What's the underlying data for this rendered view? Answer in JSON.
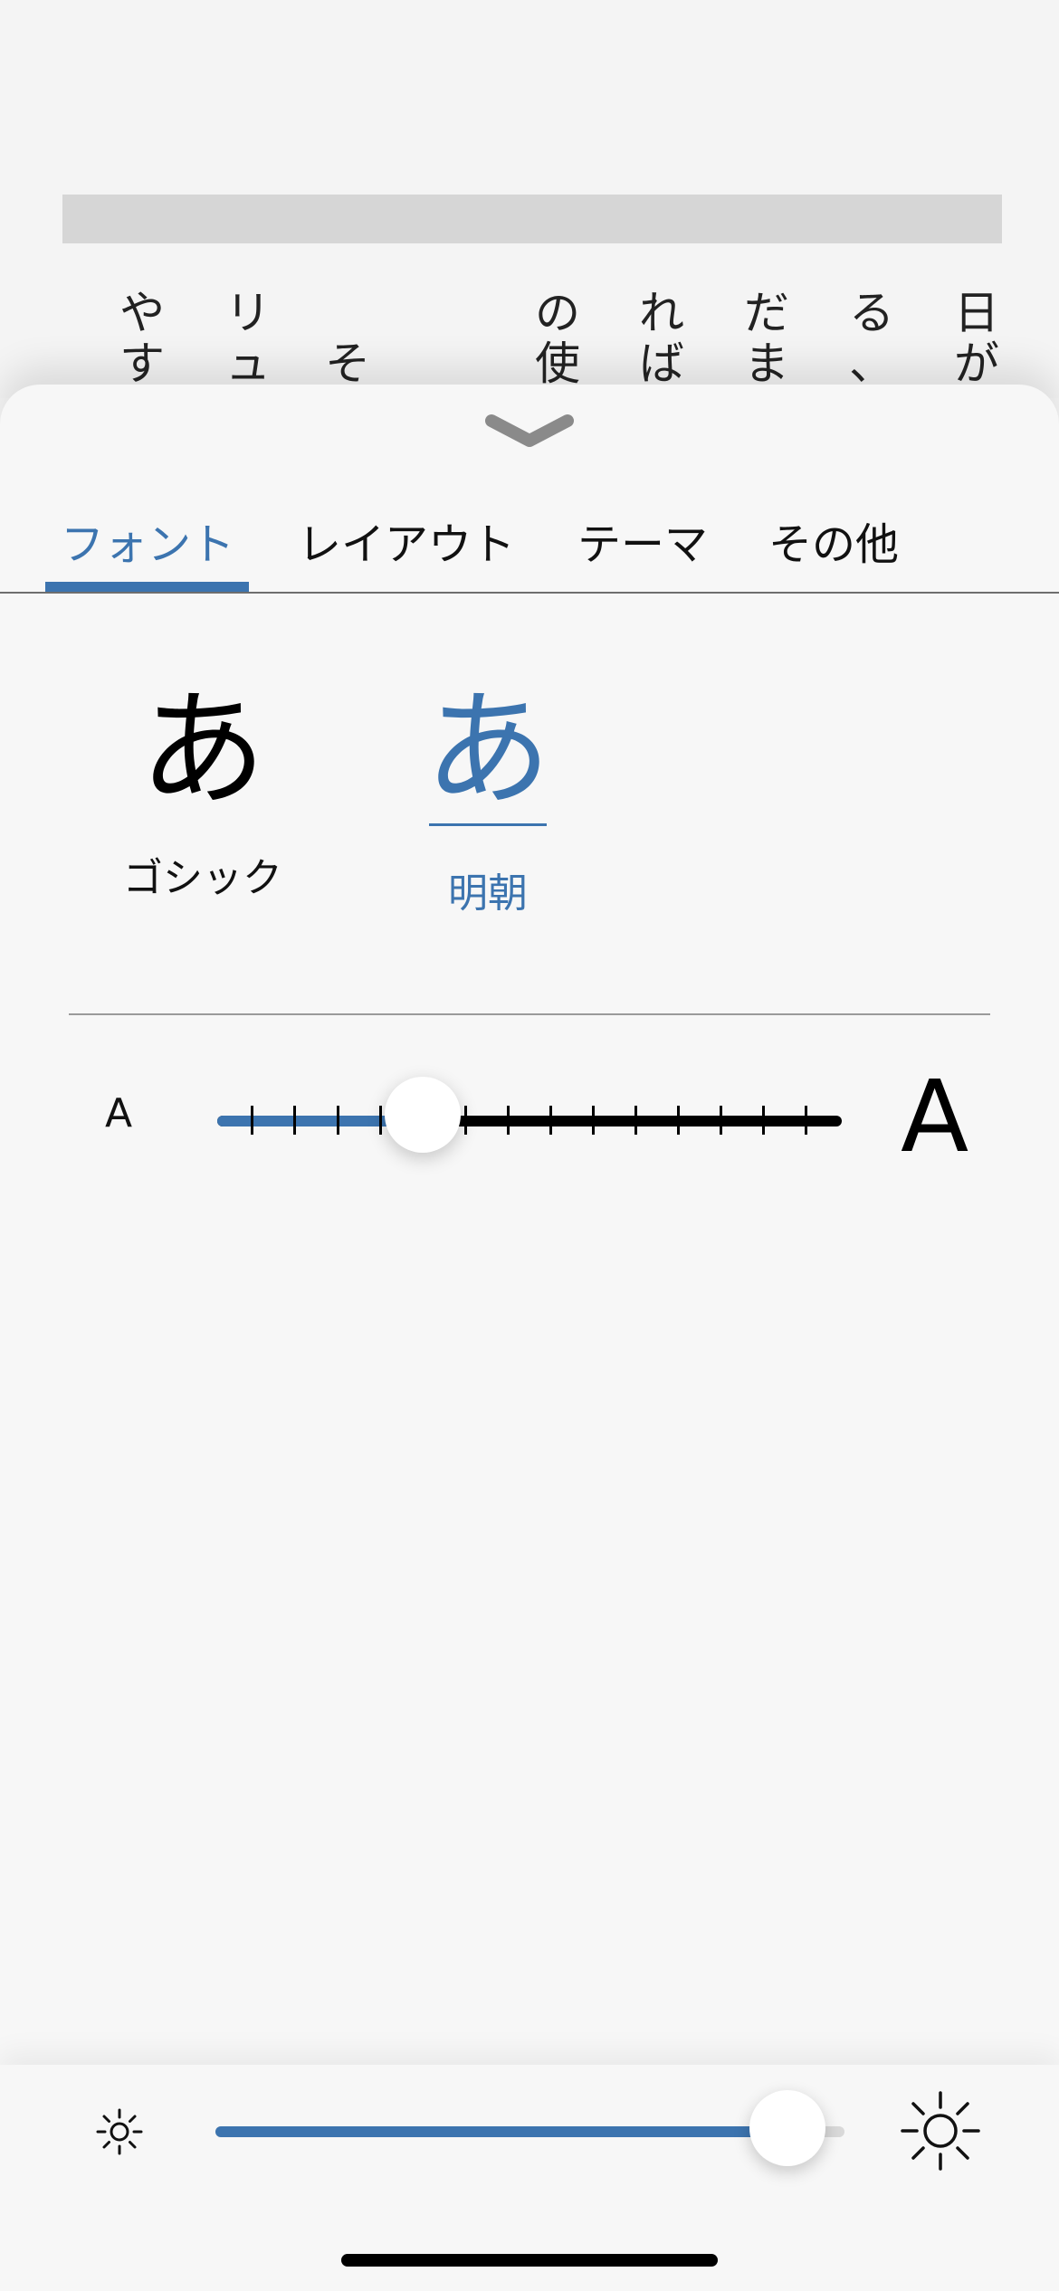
{
  "reader": {
    "columns": [
      {
        "chars": [
          "日",
          "が"
        ]
      },
      {
        "chars": [
          "る",
          "、"
        ]
      },
      {
        "chars": [
          "だ",
          "ま"
        ]
      },
      {
        "chars": [
          "れ",
          "ば"
        ]
      },
      {
        "chars": [
          "の",
          "使"
        ]
      },
      {
        "chars": [
          "",
          "そ"
        ]
      },
      {
        "chars": [
          "リ",
          "ュ"
        ]
      },
      {
        "chars": [
          "や",
          "す"
        ]
      }
    ]
  },
  "tabs": [
    {
      "label": "フォント",
      "active": true
    },
    {
      "label": "レイアウト",
      "active": false
    },
    {
      "label": "テーマ",
      "active": false
    },
    {
      "label": "その他",
      "active": false
    }
  ],
  "fonts": [
    {
      "glyph": "あ",
      "label": "ゴシック",
      "selected": false
    },
    {
      "glyph": "あ",
      "label": "明朝",
      "selected": true
    }
  ],
  "font_size": {
    "min_label": "A",
    "max_label": "A",
    "steps": 15,
    "value_index": 4
  },
  "brightness": {
    "level_fraction": 0.93
  },
  "colors": {
    "accent": "#3c74af",
    "text": "#111111",
    "background": "#f7f7f7"
  },
  "icons": {
    "collapse": "chevron-down-icon",
    "brightness_low": "sun-small-icon",
    "brightness_high": "sun-large-icon"
  }
}
